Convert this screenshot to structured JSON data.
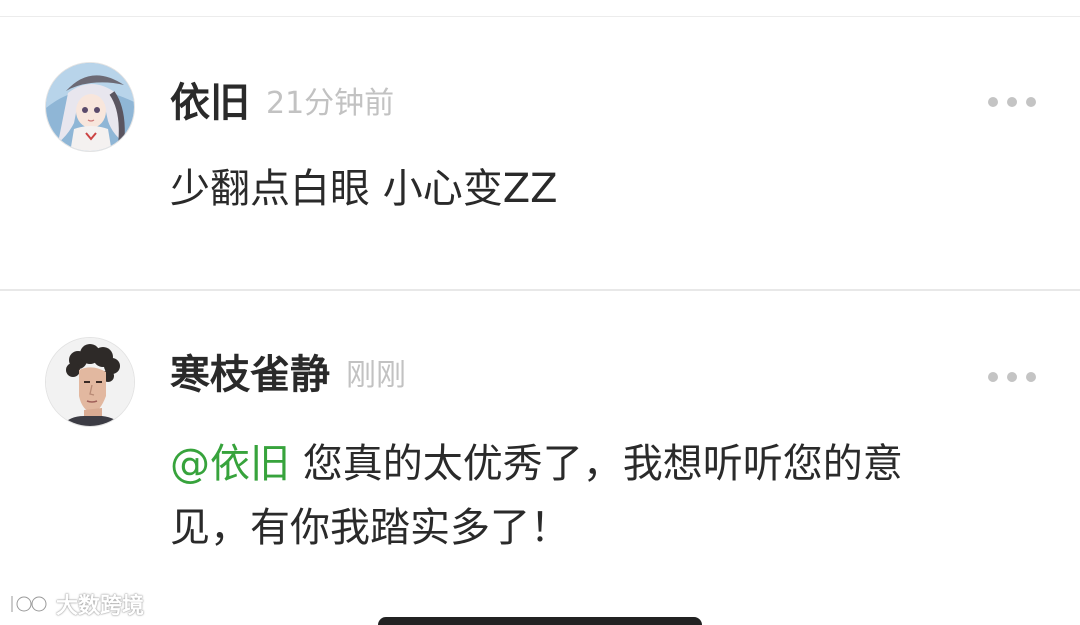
{
  "comments": [
    {
      "username": "依旧",
      "timestamp": "21分钟前",
      "body": "少翻点白眼 小心变ZZ",
      "avatar_icon": "anime-girl-avatar",
      "more_icon": "more-dots-icon"
    },
    {
      "username": "寒枝雀静",
      "timestamp": "刚刚",
      "mention": "@依旧",
      "body_line1": " 您真的太优秀了，我想听听您的意",
      "body_line2": "见，有你我踏实多了！",
      "avatar_icon": "man-portrait-avatar",
      "more_icon": "more-dots-icon"
    }
  ],
  "watermark": {
    "text": "大数跨境"
  },
  "colors": {
    "mention": "#37a33c",
    "username": "#2a2a2a",
    "timestamp": "#c2c2c2",
    "divider": "#e8e8e8"
  }
}
